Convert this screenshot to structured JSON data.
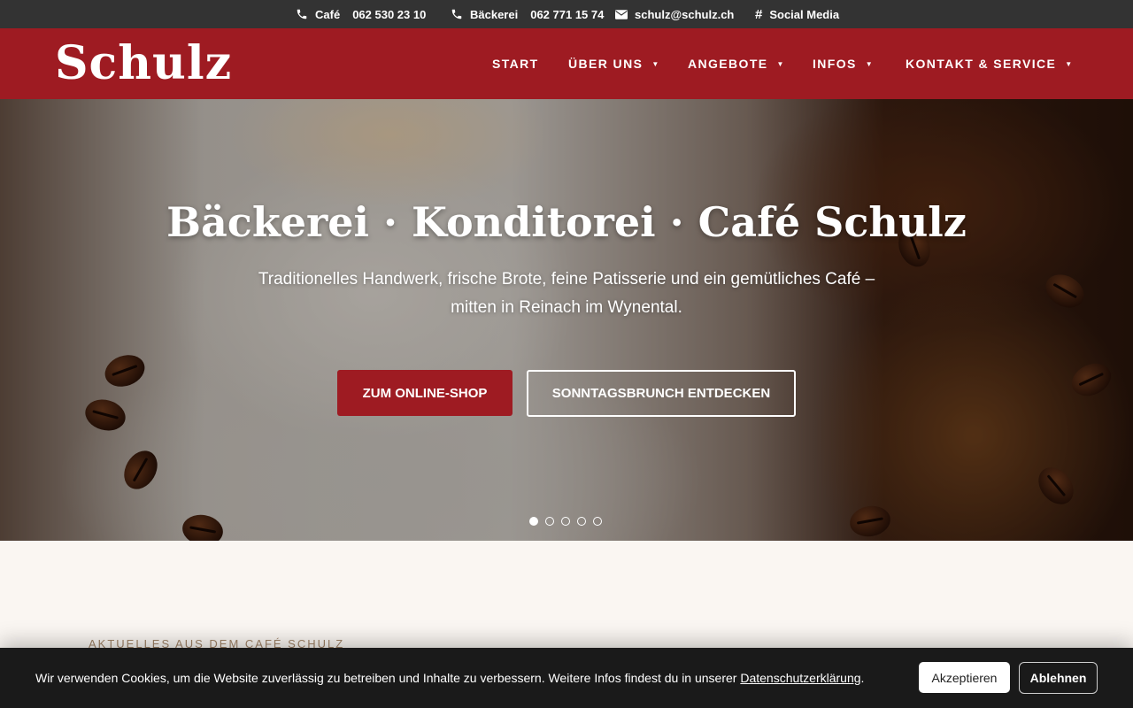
{
  "topbar": {
    "cafe_label": "Café",
    "cafe_phone": "062 530 23 10",
    "baeckerei_label": "Bäckerei",
    "baeckerei_phone": "062 771 15 74",
    "email": "schulz@schulz.ch",
    "social": "Social Media",
    "icons": [
      "phone-icon",
      "phone-icon",
      "envelope-icon",
      "hashtag-icon"
    ]
  },
  "nav": {
    "logo": "Schulz",
    "items": [
      {
        "label": "START",
        "has_dropdown": false
      },
      {
        "label": "ÜBER UNS",
        "has_dropdown": true
      },
      {
        "label": "ANGEBOTE",
        "has_dropdown": true
      },
      {
        "label": "INFOS",
        "has_dropdown": true
      },
      {
        "label": "KONTAKT & SERVICE",
        "has_dropdown": true
      }
    ],
    "caret": "▼"
  },
  "hero": {
    "title": "Bäckerei · Konditorei · Café Schulz",
    "subtitle_line1": "Traditionelles Handwerk, frische Brote, feine Patisserie und ein gemütliches Café –",
    "subtitle_line2": "mitten in Reinach im Wynental.",
    "primary_button": "ZUM ONLINE-SHOP",
    "secondary_button": "SONNTAGSBRUNCH ENTDECKEN",
    "slide_count": 5,
    "active_slide": 1
  },
  "section": {
    "label": "AKTUELLES AUS DEM CAFÉ SCHULZ"
  },
  "cookie": {
    "text": "Wir verwenden Cookies, um die Website zuverlässig zu betreiben und Inhalte zu verbessern. Weitere Infos findest du in unserer ",
    "link": "Datenschutzerklärung",
    "period": ".",
    "accept": "Akzeptieren",
    "decline": "Ablehnen"
  },
  "colors": {
    "brand_red": "#9e1b22",
    "topbar": "#333333",
    "cookie_bar": "#1a1a1a",
    "page_bg": "#faf6f2"
  }
}
